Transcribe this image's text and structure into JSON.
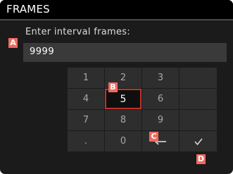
{
  "header": {
    "title": "FRAMES"
  },
  "input": {
    "label": "Enter interval frames:",
    "value": "9999"
  },
  "keypad": {
    "keys": [
      {
        "label": "1",
        "selected": false
      },
      {
        "label": "2",
        "selected": false
      },
      {
        "label": "3",
        "selected": false
      },
      {
        "label": "",
        "selected": false
      },
      {
        "label": "4",
        "selected": false
      },
      {
        "label": "5",
        "selected": true
      },
      {
        "label": "6",
        "selected": false
      },
      {
        "label": "",
        "selected": false
      },
      {
        "label": "7",
        "selected": false
      },
      {
        "label": "8",
        "selected": false
      },
      {
        "label": "9",
        "selected": false
      },
      {
        "label": "",
        "selected": false
      },
      {
        "label": ".",
        "selected": false
      },
      {
        "label": "0",
        "selected": false
      },
      {
        "label": "",
        "icon": "backspace-arrow-icon",
        "selected": false
      },
      {
        "label": "",
        "icon": "checkmark-icon",
        "selected": false
      }
    ]
  },
  "markers": {
    "a": "A",
    "b": "B",
    "c": "C",
    "d": "D"
  },
  "colors": {
    "selection_border": "#c0322b",
    "marker_fill": "#ef6a5e",
    "background": "#1b1b1b"
  }
}
